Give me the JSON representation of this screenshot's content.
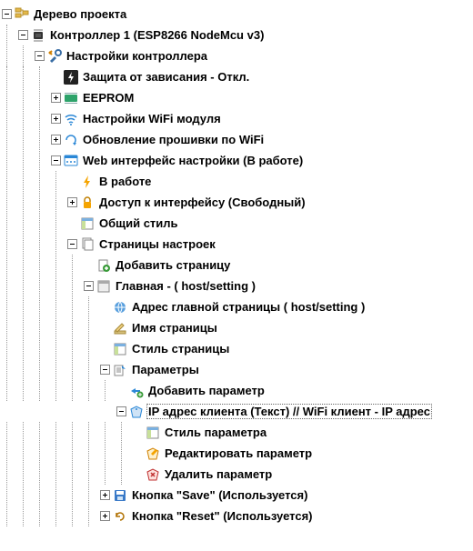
{
  "root": {
    "label": "Дерево проекта"
  },
  "controller": {
    "label": "Контроллер 1 (ESP8266 NodeMcu v3)"
  },
  "settings": {
    "label": "Настройки контроллера",
    "hang_protect": "Защита от зависания - Откл.",
    "eeprom": "EEPROM",
    "wifi_module": "Настройки WiFi модуля",
    "fw_update": "Обновление прошивки по WiFi"
  },
  "web": {
    "label": "Web интерфейс настройки (В работе)",
    "in_work": "В работе",
    "access": "Доступ к интерфейсу (Свободный)",
    "style": "Общий стиль"
  },
  "pages": {
    "label": "Страницы настроек",
    "add_page": "Добавить страницу"
  },
  "main_page": {
    "label": "Главная -  ( host/setting )",
    "addr": "Адрес главной страницы ( host/setting )",
    "name": "Имя страницы",
    "style": "Стиль страницы"
  },
  "params": {
    "label": "Параметры",
    "add": "Добавить параметр"
  },
  "ip_param": {
    "label": "IP адрес клиента (Текст) // WiFi клиент - IP адрес",
    "style": "Стиль параметра",
    "edit": "Редактировать параметр",
    "delete": "Удалить параметр"
  },
  "buttons": {
    "save": "Кнопка \"Save\" (Используется)",
    "reset": "Кнопка \"Reset\" (Используется)"
  }
}
